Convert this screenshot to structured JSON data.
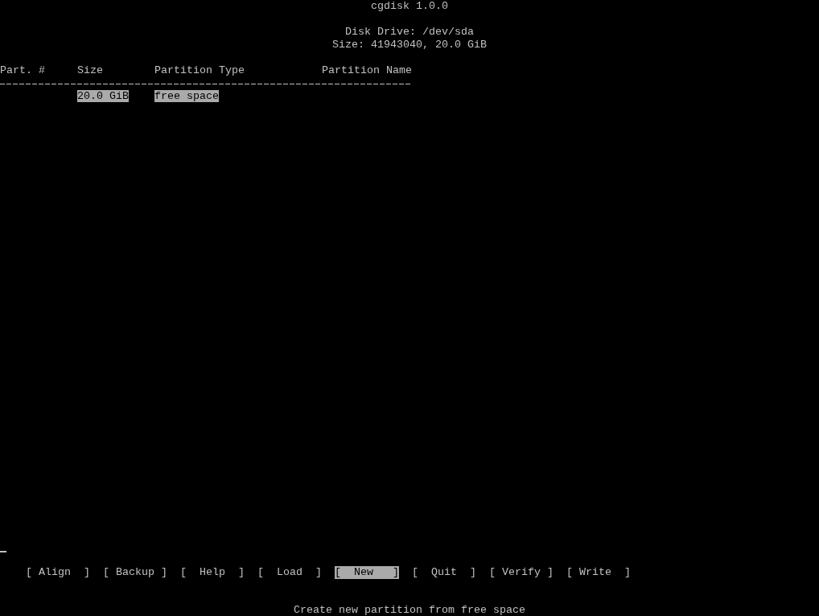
{
  "title": "cgdisk 1.0.0",
  "disk": {
    "drive": "Disk Drive: /dev/sda",
    "size": "Size: 41943040, 20.0 GiB"
  },
  "table": {
    "columns": [
      "Part. #",
      "Size",
      "Partition Type",
      "Partition Name"
    ],
    "rows": [
      {
        "size": "20.0 GiB",
        "type": "free space",
        "selected": true
      }
    ]
  },
  "buttons": [
    {
      "label": "[ Align  ]",
      "selected": false
    },
    {
      "label": "[ Backup ]",
      "selected": false
    },
    {
      "label": "[  Help  ]",
      "selected": false
    },
    {
      "label": "[  Load  ]",
      "selected": false
    },
    {
      "label": "[  New   ]",
      "selected": true
    },
    {
      "label": "[  Quit  ]",
      "selected": false
    },
    {
      "label": "[ Verify ]",
      "selected": false
    },
    {
      "label": "[ Write  ]",
      "selected": false
    }
  ],
  "status_message": "Create new partition from free space"
}
